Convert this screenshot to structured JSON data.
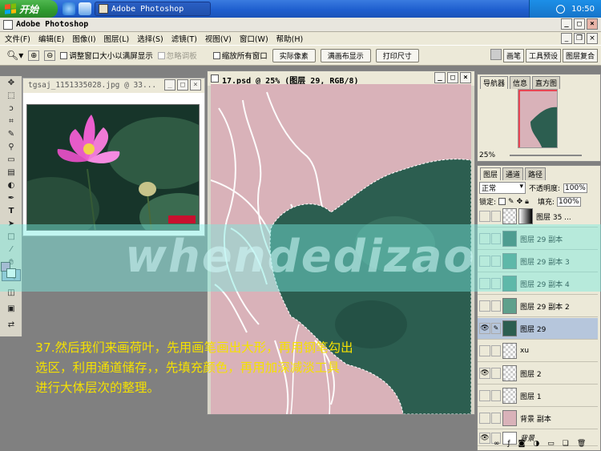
{
  "taskbar": {
    "start_label": "开始",
    "task_label": "Adobe Photoshop",
    "clock": "10:50"
  },
  "window": {
    "title": "Adobe Photoshop"
  },
  "menu": {
    "items": [
      "文件(F)",
      "编辑(E)",
      "图像(I)",
      "图层(L)",
      "选择(S)",
      "滤镜(T)",
      "视图(V)",
      "窗口(W)",
      "帮助(H)"
    ]
  },
  "options_bar": {
    "checkbox_resize": "调整窗口大小以满屏显示",
    "checkbox_ignore_palettes": "忽略调板",
    "checkbox_zoom_all": "缩放所有窗口",
    "btn_actual_pixels": "实际像素",
    "btn_fit_screen": "满画布显示",
    "btn_print_size": "打印尺寸",
    "palette_tabs": [
      "画笔",
      "工具预设",
      "图层复合"
    ]
  },
  "doc1": {
    "title": "tgsaj_1151335028.jpg @ 33..."
  },
  "doc2": {
    "title": "17.psd @ 25% (图层 29, RGB/8)"
  },
  "navigator": {
    "tabs": [
      "导航器",
      "信息",
      "直方图"
    ],
    "zoom": "25%"
  },
  "layers": {
    "tabs": [
      "图层",
      "通道",
      "路径"
    ],
    "blend_mode": "正常",
    "opacity_label": "不透明度:",
    "opacity_value": "100%",
    "lock_label": "锁定:",
    "fill_label": "填充:",
    "fill_value": "100%",
    "rows": [
      {
        "name": "图层 35 ..."
      },
      {
        "name": "图层 29 副本"
      },
      {
        "name": "图层 29 副本 3"
      },
      {
        "name": "图层 29 副本 4"
      },
      {
        "name": "图层 29 副本 2"
      },
      {
        "name": "图层 29"
      },
      {
        "name": "xu"
      },
      {
        "name": "图层 2"
      },
      {
        "name": "图层 1"
      },
      {
        "name": "背景 副本"
      },
      {
        "name": "背景"
      }
    ]
  },
  "caption": {
    "line1": "37.然后我们来画荷叶，先用画笔画出大形，再用钢笔勾出",
    "line2": "选区，利用通道储存，，先填充颜色，再用加深减淡工具",
    "line3": "进行大体层次的整理。"
  },
  "watermark": "whendedizao",
  "colors": {
    "taskbar_blue": "#1f5fcf",
    "start_green": "#2f9a2f",
    "canvas_pink": "#d9b2b9",
    "leaf_green": "#2c5e50",
    "caption_yellow": "#f5e100",
    "selected_layer": "#b6c6dc"
  }
}
